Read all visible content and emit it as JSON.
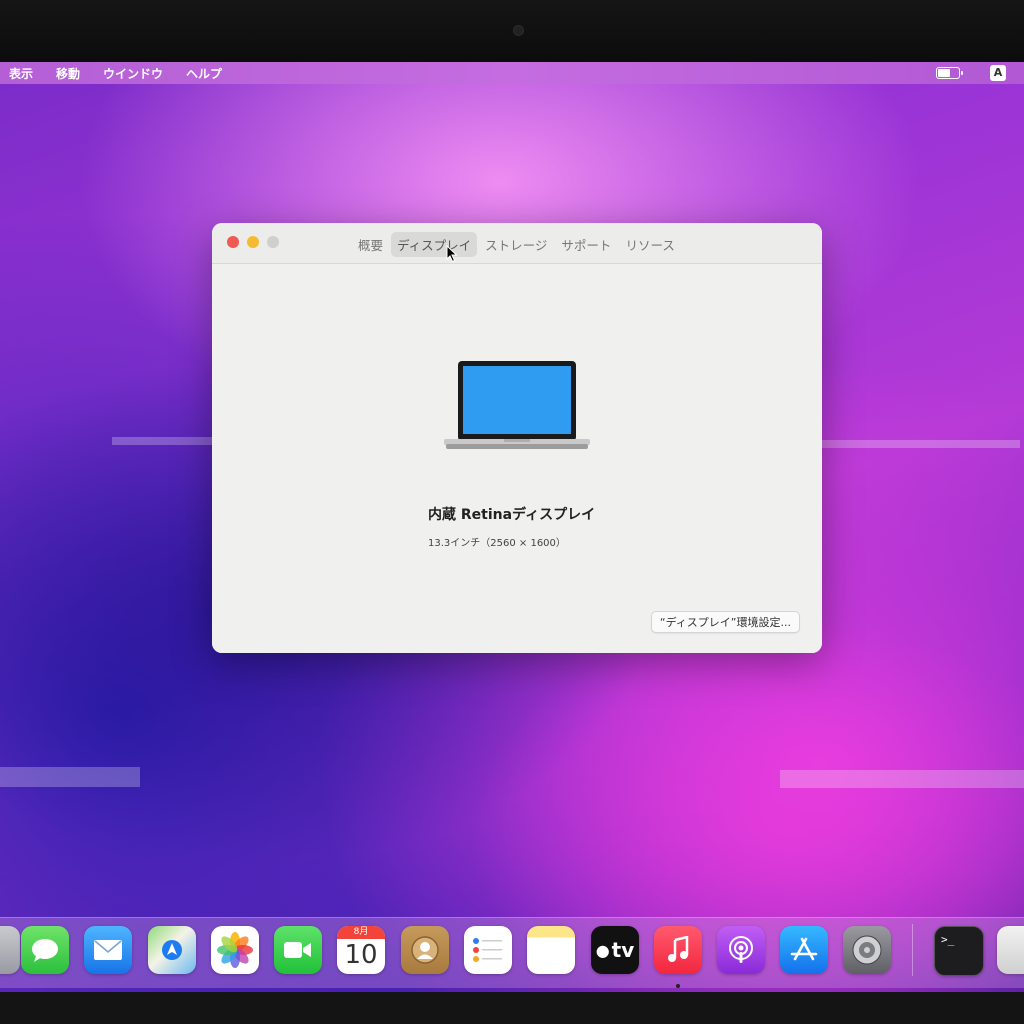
{
  "menubar": {
    "items": [
      "表示",
      "移動",
      "ウインドウ",
      "ヘルプ"
    ],
    "battery_level_pct": 60,
    "input_source": "A"
  },
  "window": {
    "tabs": [
      "概要",
      "ディスプレイ",
      "ストレージ",
      "サポート",
      "リソース"
    ],
    "active_tab": "ディスプレイ",
    "display_name": "内蔵 Retinaディスプレイ",
    "display_spec": "13.3インチ（2560 × 1600）",
    "prefs_button": "“ディスプレイ”環境設定..."
  },
  "dock": {
    "calendar_month": "8月",
    "calendar_day": "10",
    "tv_label": "tv",
    "apps": [
      "messages-icon",
      "mail-icon",
      "maps-icon",
      "photos-icon",
      "facetime-icon",
      "calendar-icon",
      "contacts-icon",
      "reminders-icon",
      "notes-icon",
      "apple-tv-icon",
      "music-icon",
      "podcasts-icon",
      "app-store-icon",
      "system-preferences-icon",
      "terminal-icon",
      "system-information-icon"
    ]
  },
  "colors": {
    "close": "#ef5a52",
    "minimize": "#f4bb2f",
    "zoom": "#cfcfce",
    "laptop_screen": "#2f9cf1"
  }
}
